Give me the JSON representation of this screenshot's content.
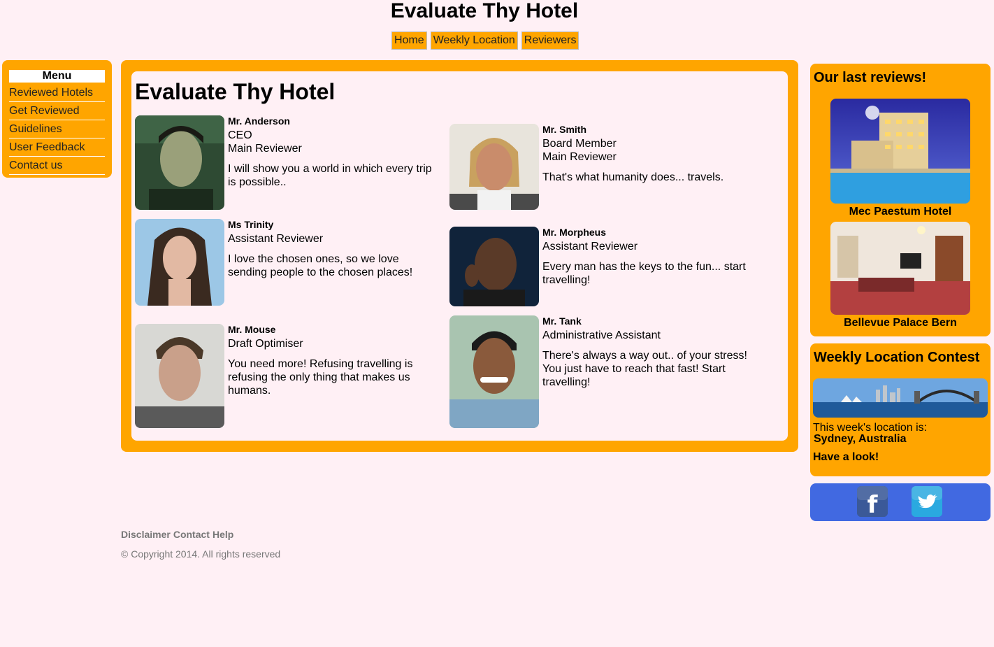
{
  "site": {
    "title": "Evaluate Thy Hotel"
  },
  "topnav": [
    "Home",
    "Weekly Location",
    "Reviewers"
  ],
  "menu": {
    "heading": "Menu",
    "items": [
      "Reviewed Hotels",
      "Get Reviewed",
      "Guidelines",
      "User Feedback",
      "Contact us"
    ]
  },
  "main": {
    "heading": "Evaluate Thy Hotel",
    "reviewers": [
      {
        "name": "Mr. Anderson",
        "roles": [
          "CEO",
          "Main Reviewer"
        ],
        "quote": "I will show you a world in which every trip is possible.."
      },
      {
        "name": "Mr. Smith",
        "roles": [
          "Board Member",
          "Main Reviewer"
        ],
        "quote": "That's what humanity does... travels."
      },
      {
        "name": "Ms Trinity",
        "roles": [
          "Assistant Reviewer"
        ],
        "quote": "I love the chosen ones, so we love sending people to the chosen places!"
      },
      {
        "name": "Mr. Morpheus",
        "roles": [
          "Assistant Reviewer"
        ],
        "quote": "Every man has the keys to the fun... start travelling!"
      },
      {
        "name": "Mr. Mouse",
        "roles": [
          "Draft Optimiser"
        ],
        "quote": "You need more! Refusing travelling is refusing the only thing that makes us humans."
      },
      {
        "name": "Mr. Tank",
        "roles": [
          "Administrative Assistant"
        ],
        "quote": "There's always a way out.. of your stress! You just have to reach that fast! Start travelling!"
      }
    ]
  },
  "sidebar": {
    "reviews_title": "Our last reviews!",
    "hotels": [
      "Mec Paestum Hotel",
      "Bellevue Palace Bern"
    ],
    "contest": {
      "title": "Weekly Location Contest",
      "intro": "This week's location is:",
      "location": "Sydney, Australia",
      "cta": "Have a look!"
    },
    "social": {
      "facebook_glyph": "f"
    }
  },
  "footer": {
    "links": [
      "Disclaimer",
      "Contact",
      "Help"
    ],
    "copyright": "© Copyright 2014. All rights reserved"
  },
  "colors": {
    "accent": "#ffa500",
    "background": "#fff0f5",
    "social": "#4169e1"
  }
}
